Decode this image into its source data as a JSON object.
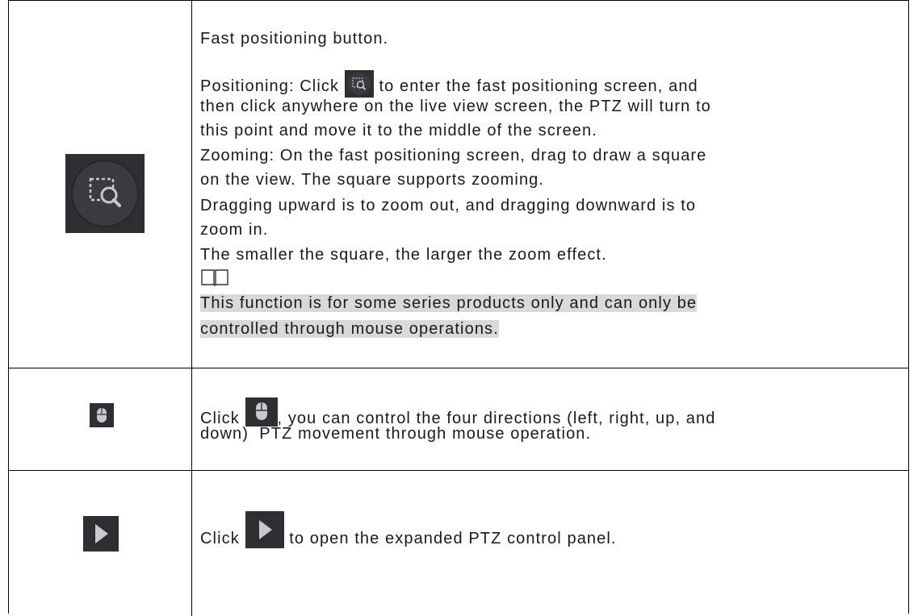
{
  "rows": [
    {
      "icon": "fast-positioning-icon",
      "title": "Fast positioning button.",
      "positioning_prefix": "Positioning: Click",
      "positioning_line1_suffix": "to enter the fast positioning screen, and",
      "positioning_line2": "then click anywhere on the live view screen, the PTZ will turn to",
      "positioning_line3": "this point and move it to the middle of the screen.",
      "zooming_line1": "Zooming: On the fast positioning screen, drag to draw a square",
      "zooming_line2": "on the view. The square supports zooming.",
      "drag_line1": "Dragging upward is to zoom out, and dragging downward is to",
      "drag_line2": "zoom in.",
      "smaller_line": "The smaller the square, the larger the zoom effect.",
      "note_icon": "book-icon",
      "note_line1": "This function is for some series products only and can only be",
      "note_line2": "controlled through mouse operations."
    },
    {
      "icon": "mouse-icon",
      "line1_prefix": "Click",
      "line1_suffix": ", you can control the four directions (left, right, up, and",
      "line2": "down)  PTZ movement through mouse operation."
    },
    {
      "icon": "play-arrow-icon",
      "prefix": "Click",
      "suffix": "to open the expanded PTZ control panel."
    }
  ],
  "colors": {
    "icon_background": "#2e2f33",
    "icon_glyph": "#c8c9cc",
    "note_highlight": "#d9d9d9",
    "border": "#000000"
  }
}
